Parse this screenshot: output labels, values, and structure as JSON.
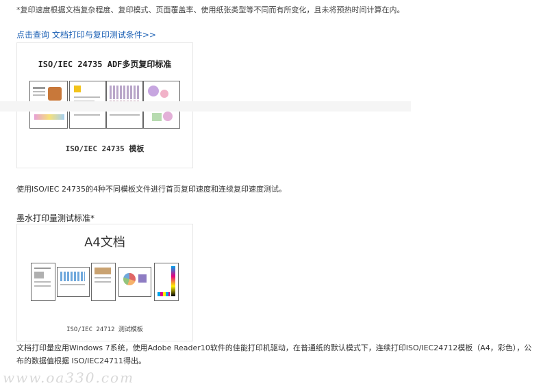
{
  "note_text": "*复印速度根据文档复杂程度、复印模式、页面覆盖率、使用纸张类型等不同而有所变化，且未将预热时间计算在内。",
  "link_text": "点击查询 文档打印与复印测试条件>>",
  "panel1": {
    "title": "ISO/IEC 24735 ADF多页复印标准",
    "caption": "ISO/IEC 24735 模板"
  },
  "body_text_1": "使用ISO/IEC 24735的4种不同模板文件进行首页复印速度和连续复印速度测试。",
  "heading_2": "墨水打印量测试标准*",
  "panel2": {
    "title": "A4文档",
    "caption": "ISO/IEC 24712 测试模板"
  },
  "body_text_2": "文档打印量应用Windows 7系统，使用Adobe Reader10软件的佳能打印机驱动，在普通纸的默认模式下，连续打印ISO/IEC24712模板（A4，彩色），公",
  "body_text_3": "布的数据值根据 ISO/IEC24711得出。",
  "watermark": "www.oa330.com",
  "colors": {
    "link": "#1a5fb4",
    "text": "#333333"
  }
}
